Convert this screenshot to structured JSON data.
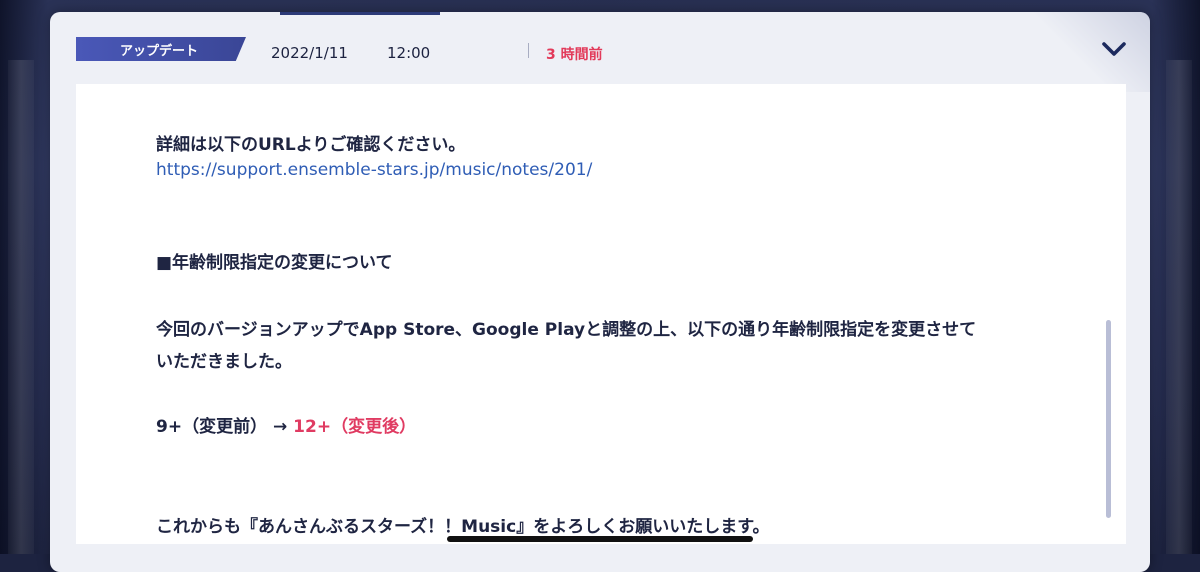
{
  "header": {
    "category": "アップデート",
    "date": "2022/1/11",
    "time": "12:00",
    "ago": "3 時間前"
  },
  "icons": {
    "collapse": "chevron-down-icon"
  },
  "body": {
    "detail_label": "詳細は以下のURLよりご確認ください。",
    "detail_link": "https://support.ensemble-stars.jp/music/notes/201/",
    "section_heading": "■年齢制限指定の変更について",
    "paragraph_line1": "今回のバージョンアップでApp Store、Google Playと調整の上、以下の通り年齢制限指定を変更させて",
    "paragraph_line2": "いただきました。",
    "rating_before": "9+（変更前）",
    "rating_arrow": "→",
    "rating_after": "12+（変更後）",
    "closing": "これからも『あんさんぶるスターズ！！Music』をよろしくお願いいたします。"
  },
  "colors": {
    "accent_pink": "#e03b62",
    "link_blue": "#2f5db5",
    "badge_blue": "#4a58b8",
    "text_navy": "#1f2542"
  }
}
